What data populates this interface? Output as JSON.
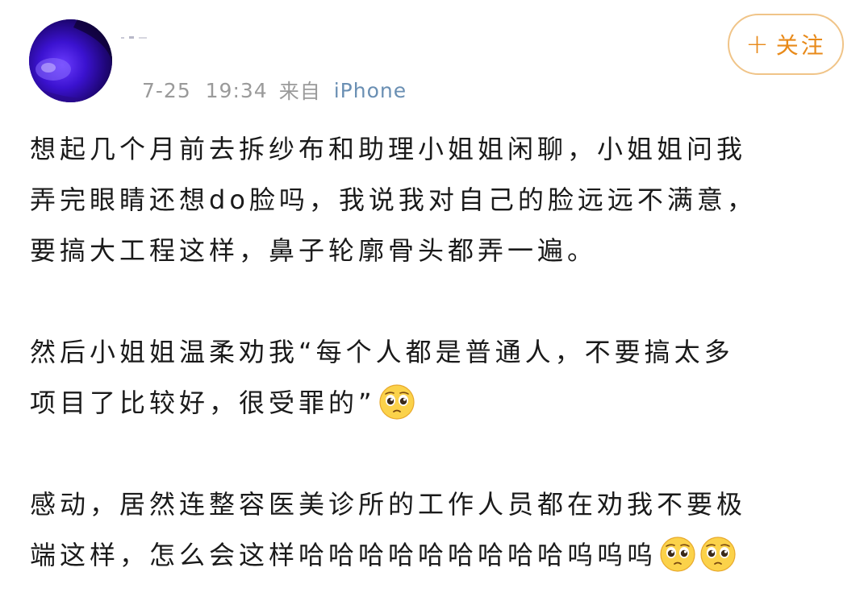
{
  "header": {
    "time": "7-25",
    "clock": "19:34",
    "from_prefix": "来自",
    "source": "iPhone",
    "follow_plus": "+",
    "follow_label": "关注"
  },
  "post": {
    "paragraph_1_line_1": "想起几个月前去拆纱布和助理小姐姐闲聊，小姐姐问我",
    "paragraph_1_line_2": "弄完眼睛还想do脸吗，我说我对自己的脸远远不满意，",
    "paragraph_1_line_3": "要搞大工程这样，鼻子轮廓骨头都弄一遍。",
    "paragraph_2_line_1": "然后小姐姐温柔劝我“每个人都是普通人，不要搞太多",
    "paragraph_2_line_2": "项目了比较好，很受罪的”",
    "paragraph_3_line_1": "感动，居然连整容医美诊所的工作人员都在劝我不要极",
    "paragraph_3_line_2": "端这样，怎么会这样哈哈哈哈哈哈哈哈哈呜呜呜",
    "emoji_name": "pleading-face-icon"
  },
  "colors": {
    "accent": "#e88a1a",
    "follow_border": "#f0c488",
    "meta_text": "#9a9a9a",
    "source_text": "#6a8fb3",
    "body_text": "#1a1a1a"
  }
}
